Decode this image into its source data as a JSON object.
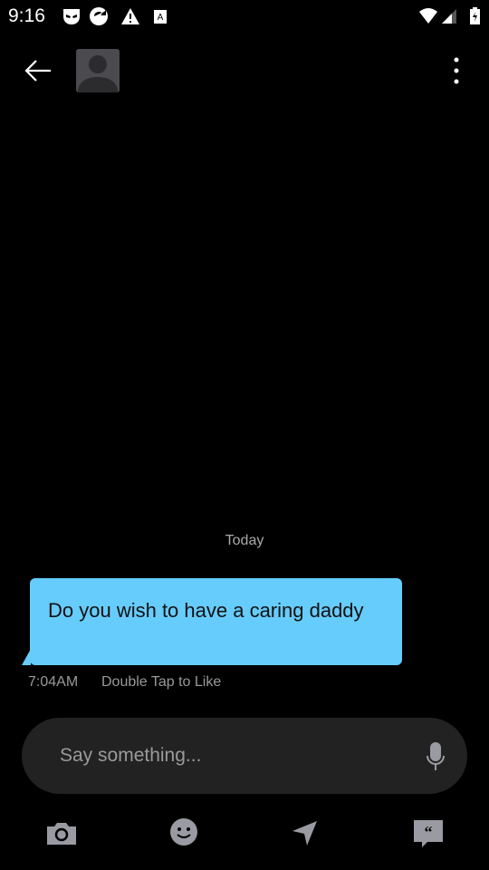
{
  "status_bar": {
    "time": "9:16",
    "icons": [
      "grindr-icon",
      "sync-icon",
      "warning-icon",
      "font-icon",
      "wifi-icon",
      "signal-icon",
      "battery-charging-icon"
    ]
  },
  "header": {
    "back": "back-arrow-icon",
    "avatar": "profile-avatar",
    "menu": "more-vert-icon"
  },
  "chat": {
    "date_divider": "Today",
    "messages": [
      {
        "text": "Do you wish to have a caring daddy",
        "time": "7:04AM",
        "hint": "Double Tap to Like"
      }
    ]
  },
  "composer": {
    "placeholder": "Say something...",
    "value": ""
  },
  "toolbar": [
    "camera-icon",
    "emoji-icon",
    "location-icon",
    "saved-phrases-icon"
  ],
  "colors": {
    "bubble": "#66ccfc",
    "icon": "#9a9aa3"
  }
}
